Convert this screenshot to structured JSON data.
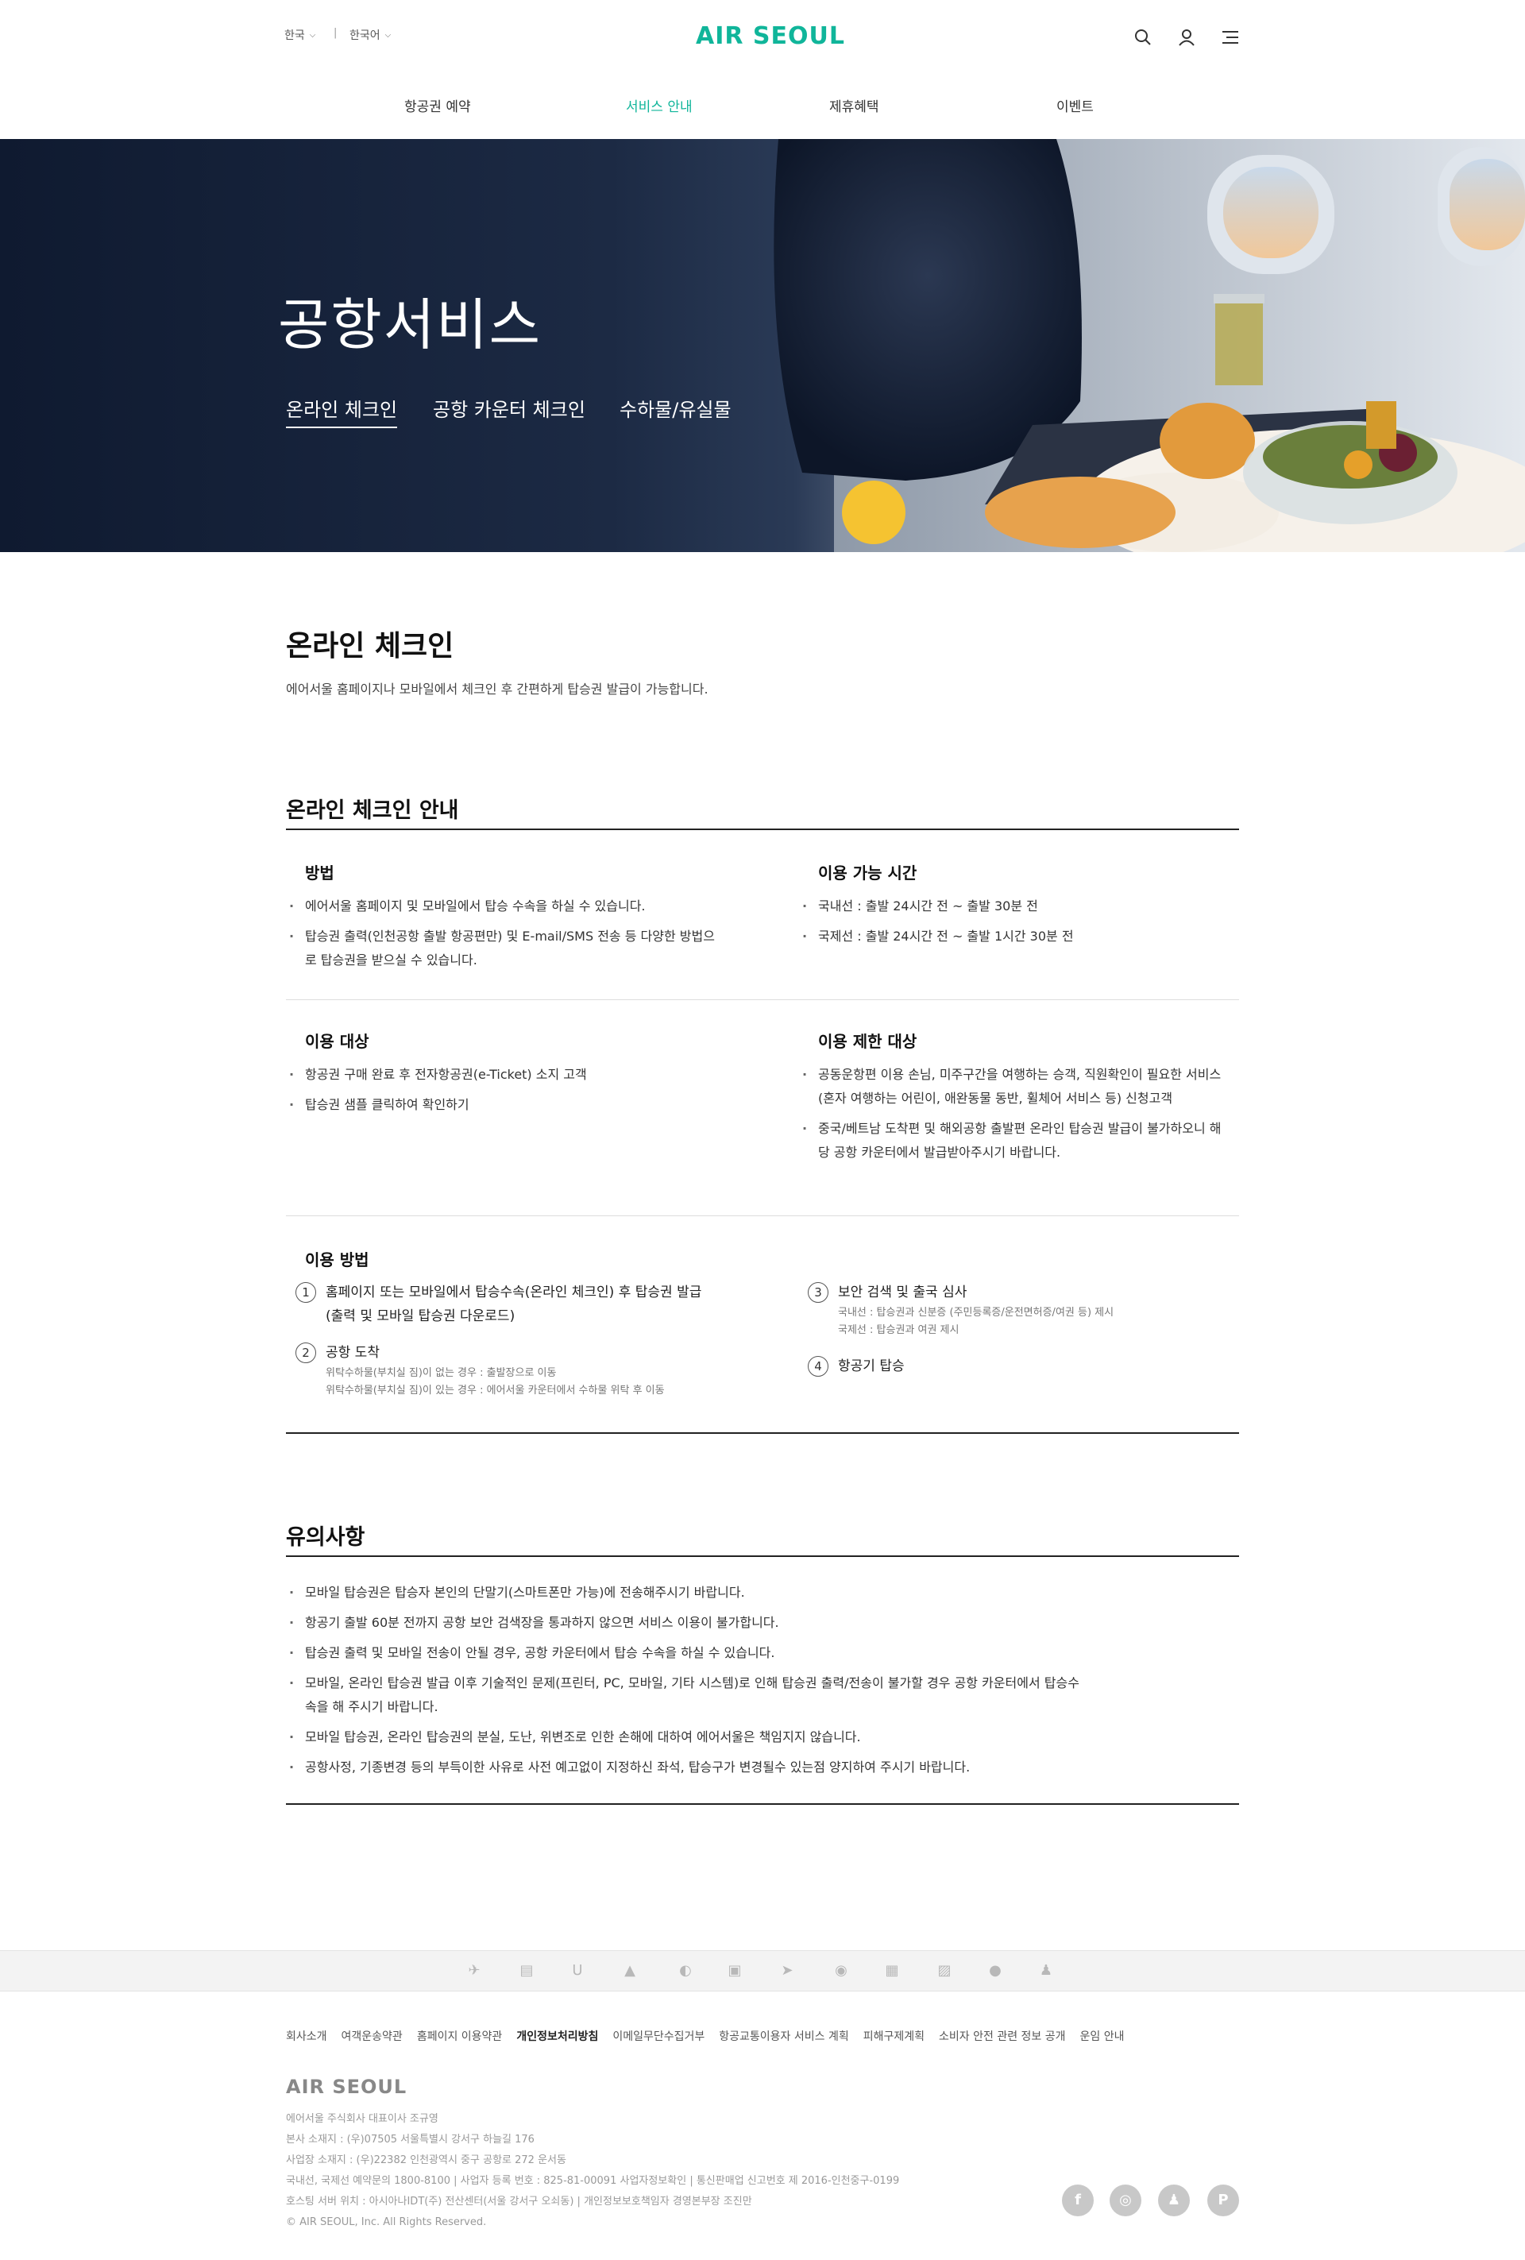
{
  "header": {
    "region": "한국",
    "language": "한국어",
    "logo": "AIR SEOUL",
    "nav": [
      "항공권 예약",
      "서비스 안내",
      "제휴혜택",
      "이벤트"
    ]
  },
  "hero": {
    "title": "공항서비스",
    "tabs": [
      "온라인 체크인",
      "공항 카운터 체크인",
      "수하물/유실물"
    ]
  },
  "main": {
    "title": "온라인 체크인",
    "lead": "에어서울 홈페이지나 모바일에서 체크인 후 간편하게 탑승권 발급이 가능합니다.",
    "guide": {
      "title": "온라인 체크인 안내",
      "method": {
        "title": "방법",
        "items": [
          "에어서울 홈페이지 및 모바일에서 탑승 수속을 하실 수 있습니다.",
          "탑승권 출력(인천공항 출발 항공편만) 및 E-mail/SMS 전송 등 다양한 방법으로 탑승권을 받으실 수 있습니다."
        ]
      },
      "time": {
        "title": "이용 가능 시간",
        "items": [
          "국내선 : 출발 24시간 전 ~ 출발 30분 전",
          "국제선 : 출발 24시간 전 ~ 출발 1시간 30분 전"
        ]
      },
      "target": {
        "title": "이용 대상",
        "items": [
          "항공권 구매 완료 후 전자항공권(e-Ticket) 소지 고객",
          "탑승권 샘플 클릭하여 확인하기"
        ]
      },
      "restricted": {
        "title": "이용 제한 대상",
        "items": [
          "공동운항편 이용 손님, 미주구간을 여행하는 승객, 직원확인이 필요한 서비스 (혼자 여행하는 어린이, 애완동물 동반, 휠체어 서비스 등) 신청고객",
          "중국/베트남 도착편 및 해외공항 출발편 온라인 탑승권 발급이 불가하오니 해당 공항 카운터에서 발급받아주시기 바랍니다."
        ]
      },
      "howto": {
        "title": "이용 방법",
        "steps": [
          {
            "num": "1",
            "text": "홈페이지 또는 모바일에서 탑승수속(온라인 체크인) 후 탑승권 발급",
            "text2": "(출력 및 모바일 탑승권 다운로드)",
            "sub1": "",
            "sub2": ""
          },
          {
            "num": "2",
            "text": "공항 도착",
            "text2": "",
            "sub1": "위탁수하물(부치실 짐)이 없는 경우 : 출발장으로 이동",
            "sub2": "위탁수하물(부치실 짐)이 있는 경우 : 에어서울 카운터에서 수하물 위탁 후 이동"
          },
          {
            "num": "3",
            "text": "보안 검색 및 출국 심사",
            "text2": "",
            "sub1": "국내선 : 탑승권과 신분증 (주민등록증/운전면허증/여권 등) 제시",
            "sub2": "국제선 : 탑승권과 여권 제시"
          },
          {
            "num": "4",
            "text": "항공기 탑승",
            "text2": "",
            "sub1": "",
            "sub2": ""
          }
        ]
      }
    },
    "notice": {
      "title": "유의사항",
      "items": [
        "모바일 탑승권은 탑승자 본인의 단말기(스마트폰만 가능)에 전송해주시기 바랍니다.",
        "항공기 출발 60분 전까지 공항 보안 검색장을 통과하지 않으면 서비스 이용이 불가합니다.",
        "탑승권 출력 및 모바일 전송이 안될 경우, 공항 카운터에서 탑승 수속을 하실 수 있습니다.",
        "모바일, 온라인 탑승권 발급 이후 기술적인 문제(프린터, PC, 모바일, 기타 시스템)로 인해 탑승권 출력/전송이 불가할 경우 공항 카운터에서 탑승수속을 해 주시기 바랍니다.",
        "모바일 탑승권, 온라인 탑승권의 분실, 도난, 위변조로 인한 손해에 대하여 에어서울은 책임지지 않습니다.",
        "공항사정, 기종변경 등의 부득이한 사유로 사전 예고없이 지정하신 좌석, 탑승구가 변경될수 있는점 양지하여 주시기 바랍니다."
      ]
    }
  },
  "footer": {
    "links": [
      "회사소개",
      "여객운송약관",
      "홈페이지 이용약관",
      "개인정보처리방침",
      "이메일무단수집거부",
      "항공교통이용자 서비스 계획",
      "피해구제계획",
      "소비자 안전 관련 정보 공개",
      "운임 안내"
    ],
    "logo": "AIR SEOUL",
    "info": [
      "에어서울 주식회사 대표이사 조규영",
      "본사 소재지 : (우)07505 서울특별시 강서구 하늘길 176",
      "사업장 소재지 : (우)22382 인천광역시 중구 공항로 272 운서동",
      "국내선, 국제선 예약문의 1800-8100  |  사업자 등록 번호 : 825-81-00091 사업자정보확인  |  통신판매업 신고번호 제 2016-인천중구-0199",
      "호스팅 서버 위치 : 아시아나IDT(주) 전산센터(서울 강서구 오쇠동)  |  개인정보보호책임자 경영본부장 조진만",
      "© AIR SEOUL, Inc. All Rights Reserved."
    ],
    "sns": [
      "f",
      "◎",
      "♟",
      "P"
    ]
  },
  "colors": {
    "brand": "#10b59a"
  }
}
